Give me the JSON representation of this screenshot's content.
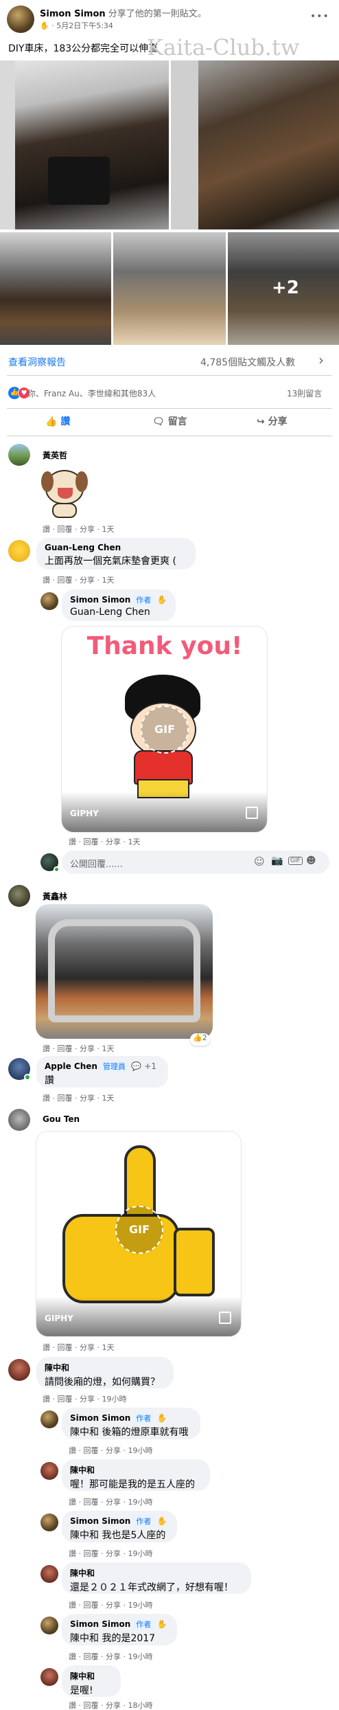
{
  "post": {
    "author": "Simon Simon",
    "action": "分享了他的第一則貼文。",
    "time": "5月2日下午5:34",
    "dot": "·",
    "text": "DIY車床，183公分都完全可以伸直",
    "watermark": "Kaita-Club.tw",
    "more_photos": "+2",
    "more_icon": "•••"
  },
  "insights": {
    "view_label": "查看洞察報告",
    "reach": "4,785個貼文觸及人數"
  },
  "reactions": {
    "summary": "你、Franz Au、李世緯和其他83人",
    "comments_count": "13則留言"
  },
  "buttons": {
    "like": "讚",
    "comment": "留言",
    "share": "分享"
  },
  "actions_text": {
    "base": "讚 · 回覆 · 分享 ·"
  },
  "reply_box": {
    "placeholder": "公開回覆......"
  },
  "gifs": {
    "thank_you_text": "Thank you!",
    "gif_label": "GIF",
    "giphy_label": "GIPHY"
  },
  "comments": [
    {
      "name": "黃英哲",
      "text": "",
      "time": "1天"
    },
    {
      "name": "Guan-Leng Chen",
      "text": "上面再放一個充氣床墊會更爽 (",
      "time": "1天"
    },
    {
      "name": "Simon Simon",
      "badge": "作者",
      "text": "Guan-Leng Chen",
      "time": "1天"
    },
    {
      "name": "黃鑫林",
      "text": "",
      "time": "1天",
      "likes": "2"
    },
    {
      "name": "Apple Chen",
      "badge": "管理員",
      "text": "讚",
      "time": "1天",
      "extra": "+1"
    },
    {
      "name": "Gou Ten",
      "text": "",
      "time": "1天"
    },
    {
      "name": "陳中和",
      "text": "請問後廂的燈，如何購買？",
      "time": "19小時"
    },
    {
      "name": "Simon Simon",
      "badge": "作者",
      "text": "陳中和 後箱的燈原車就有哦",
      "time": "19小時"
    },
    {
      "name": "陳中和",
      "text": "喔！那可能是我的是五人座的",
      "time": "19小時"
    },
    {
      "name": "Simon Simon",
      "badge": "作者",
      "text": "陳中和 我也是5人座的",
      "time": "19小時"
    },
    {
      "name": "陳中和",
      "text": "還是２０２１年式改網了，好想有喔！",
      "time": "19小時"
    },
    {
      "name": "Simon Simon",
      "badge": "作者",
      "text": "陳中和 我的是2017",
      "time": "19小時"
    },
    {
      "name": "陳中和",
      "text": "是喔!",
      "time": "18小時"
    }
  ]
}
